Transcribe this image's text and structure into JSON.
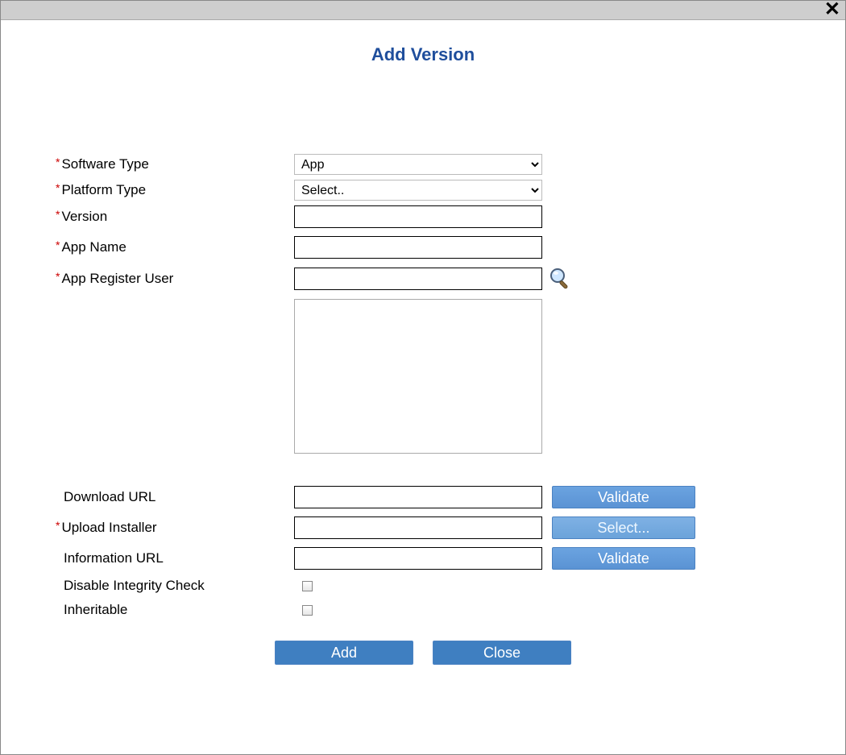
{
  "title": "Add Version",
  "labels": {
    "software_type": "Software Type",
    "platform_type": "Platform Type",
    "version": "Version",
    "app_name": "App Name",
    "app_register_user": "App Register User",
    "download_url": "Download URL",
    "upload_installer": "Upload Installer",
    "information_url": "Information URL",
    "disable_integrity": "Disable Integrity Check",
    "inheritable": "Inheritable"
  },
  "values": {
    "software_type": "App",
    "platform_type": "Select.."
  },
  "buttons": {
    "validate": "Validate",
    "select": "Select...",
    "add": "Add",
    "close": "Close"
  }
}
